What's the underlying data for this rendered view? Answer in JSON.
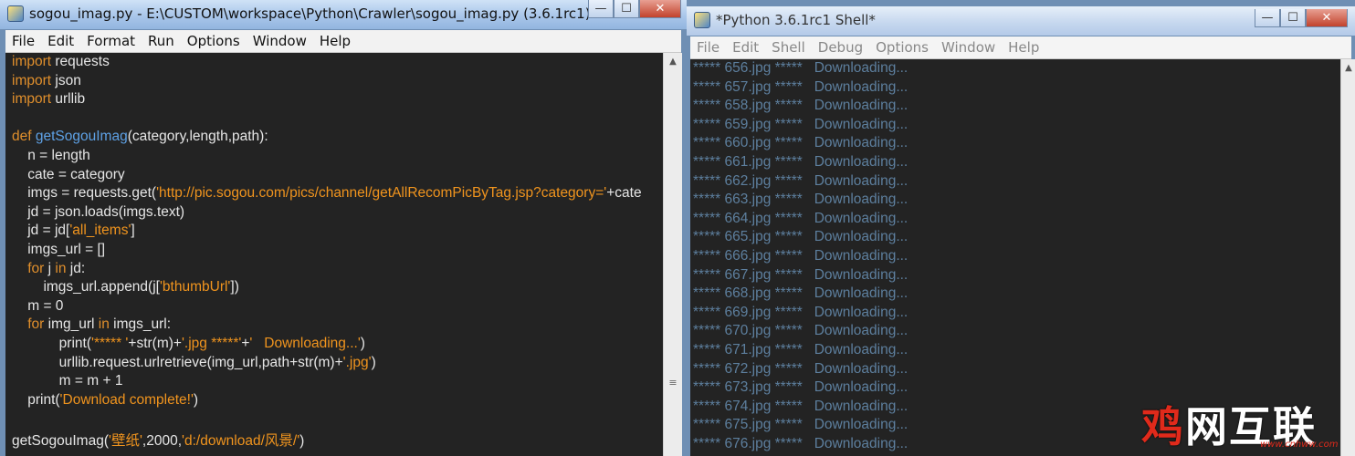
{
  "left_window": {
    "title": "sogou_imag.py - E:\\CUSTOM\\workspace\\Python\\Crawler\\sogou_imag.py (3.6.1rc1)",
    "menu": [
      "File",
      "Edit",
      "Format",
      "Run",
      "Options",
      "Window",
      "Help"
    ],
    "controls": {
      "minimize": "—",
      "maximize": "☐",
      "close": "✕"
    }
  },
  "code_lines": [
    [
      {
        "t": "kw",
        "v": "import"
      },
      {
        "t": "plain",
        "v": " requests"
      }
    ],
    [
      {
        "t": "kw",
        "v": "import"
      },
      {
        "t": "plain",
        "v": " json"
      }
    ],
    [
      {
        "t": "kw",
        "v": "import"
      },
      {
        "t": "plain",
        "v": " urllib"
      }
    ],
    [],
    [
      {
        "t": "kw",
        "v": "def"
      },
      {
        "t": "plain",
        "v": " "
      },
      {
        "t": "fn",
        "v": "getSogouImag"
      },
      {
        "t": "plain",
        "v": "(category,length,path):"
      }
    ],
    [
      {
        "t": "plain",
        "v": "    n = length"
      }
    ],
    [
      {
        "t": "plain",
        "v": "    cate = category"
      }
    ],
    [
      {
        "t": "plain",
        "v": "    imgs = requests.get("
      },
      {
        "t": "str",
        "v": "'http://pic.sogou.com/pics/channel/getAllRecomPicByTag.jsp?category='"
      },
      {
        "t": "plain",
        "v": "+cate"
      }
    ],
    [
      {
        "t": "plain",
        "v": "    jd = json.loads(imgs.text)"
      }
    ],
    [
      {
        "t": "plain",
        "v": "    jd = jd["
      },
      {
        "t": "str",
        "v": "'all_items'"
      },
      {
        "t": "plain",
        "v": "]"
      }
    ],
    [
      {
        "t": "plain",
        "v": "    imgs_url = []"
      }
    ],
    [
      {
        "t": "plain",
        "v": "    "
      },
      {
        "t": "kw",
        "v": "for"
      },
      {
        "t": "plain",
        "v": " j "
      },
      {
        "t": "kw",
        "v": "in"
      },
      {
        "t": "plain",
        "v": " jd:"
      }
    ],
    [
      {
        "t": "plain",
        "v": "        imgs_url.append(j["
      },
      {
        "t": "str",
        "v": "'bthumbUrl'"
      },
      {
        "t": "plain",
        "v": "])"
      }
    ],
    [
      {
        "t": "plain",
        "v": "    m = 0"
      }
    ],
    [
      {
        "t": "plain",
        "v": "    "
      },
      {
        "t": "kw",
        "v": "for"
      },
      {
        "t": "plain",
        "v": " img_url "
      },
      {
        "t": "kw",
        "v": "in"
      },
      {
        "t": "plain",
        "v": " imgs_url:"
      }
    ],
    [
      {
        "t": "plain",
        "v": "            print("
      },
      {
        "t": "str",
        "v": "'***** '"
      },
      {
        "t": "plain",
        "v": "+str(m)+"
      },
      {
        "t": "str",
        "v": "'.jpg *****'"
      },
      {
        "t": "plain",
        "v": "+"
      },
      {
        "t": "str",
        "v": "'   Downloading...'"
      },
      {
        "t": "plain",
        "v": ")"
      }
    ],
    [
      {
        "t": "plain",
        "v": "            urllib.request.urlretrieve(img_url,path+str(m)+"
      },
      {
        "t": "str",
        "v": "'.jpg'"
      },
      {
        "t": "plain",
        "v": ")"
      }
    ],
    [
      {
        "t": "plain",
        "v": "            m = m + 1"
      }
    ],
    [
      {
        "t": "plain",
        "v": "    print("
      },
      {
        "t": "str",
        "v": "'Download complete!'"
      },
      {
        "t": "plain",
        "v": ")"
      }
    ],
    [],
    [
      {
        "t": "plain",
        "v": "getSogouImag("
      },
      {
        "t": "str",
        "v": "'壁纸'"
      },
      {
        "t": "plain",
        "v": ",2000,"
      },
      {
        "t": "str",
        "v": "'d:/download/风景/'"
      },
      {
        "t": "plain",
        "v": ")"
      }
    ]
  ],
  "right_window": {
    "title": "*Python 3.6.1rc1 Shell*",
    "menu": [
      "File",
      "Edit",
      "Shell",
      "Debug",
      "Options",
      "Window",
      "Help"
    ],
    "controls": {
      "minimize": "—",
      "maximize": "☐",
      "close": "✕"
    }
  },
  "shell_lines": [
    "***** 656.jpg *****   Downloading...",
    "***** 657.jpg *****   Downloading...",
    "***** 658.jpg *****   Downloading...",
    "***** 659.jpg *****   Downloading...",
    "***** 660.jpg *****   Downloading...",
    "***** 661.jpg *****   Downloading...",
    "***** 662.jpg *****   Downloading...",
    "***** 663.jpg *****   Downloading...",
    "***** 664.jpg *****   Downloading...",
    "***** 665.jpg *****   Downloading...",
    "***** 666.jpg *****   Downloading...",
    "***** 667.jpg *****   Downloading...",
    "***** 668.jpg *****   Downloading...",
    "***** 669.jpg *****   Downloading...",
    "***** 670.jpg *****   Downloading...",
    "***** 671.jpg *****   Downloading...",
    "***** 672.jpg *****   Downloading...",
    "***** 673.jpg *****   Downloading...",
    "***** 674.jpg *****   Downloading...",
    "***** 675.jpg *****   Downloading...",
    "***** 676.jpg *****   Downloading..."
  ],
  "watermark": {
    "cn_a": "鸡",
    "cn_b": "网",
    "cn_c": "互联",
    "url": "www.cnhww.com"
  },
  "colors": {
    "keyword": "#e08f2c",
    "function": "#5ea1e5",
    "string": "#f0941e",
    "shell_text": "#5d7f9e",
    "editor_bg": "#232323"
  }
}
